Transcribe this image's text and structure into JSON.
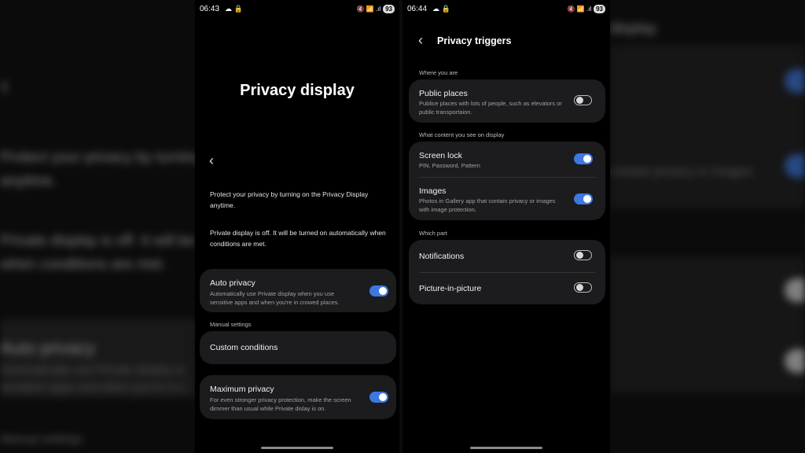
{
  "colors": {
    "accent": "#3d78e0",
    "card": "#1c1c1e",
    "background": "#000000"
  },
  "background_blur": {
    "left_lines": [
      "Protect your privacy by turning",
      "anytime.",
      "Private display is off. It will be",
      "when conditions are met.",
      "Auto privacy",
      "Automatically use Private display w",
      "sensitive apps and when you're in c",
      "Manual settings"
    ],
    "right_lines": [
      "display",
      "contain privacy or images"
    ]
  },
  "screen1": {
    "status": {
      "time": "06:43",
      "left_icons": "☁ 🔒",
      "right_icons": "🔇 📶 .ıl",
      "battery": "93"
    },
    "title": "Privacy display",
    "back_icon": "chevron-left-icon",
    "intro": "Protect your privacy by turning on the Privacy Display anytime.",
    "status_text": "Private display is off. It will be turned on automatically when conditions are met.",
    "auto_privacy": {
      "title": "Auto privacy",
      "subtitle": "Automatically use Private display when you use sensitive apps and when you're in crowed places.",
      "enabled": true
    },
    "manual_label": "Manual settings",
    "custom_conditions": {
      "title": "Custom conditions"
    },
    "maximum_privacy": {
      "title": "Maximum privacy",
      "subtitle": "For even stronger privacy protection, make the screen dimmer than usual while Private dislay is on.",
      "enabled": true
    }
  },
  "screen2": {
    "status": {
      "time": "06:44",
      "left_icons": "☁ 🔒",
      "right_icons": "🔇 📶 .ıl",
      "battery": "93"
    },
    "title": "Privacy triggers",
    "where_label": "Where you are",
    "public_places": {
      "title": "Public places",
      "subtitle": "Publice places with lots of people, such as elevators or public transportaion.",
      "enabled": false
    },
    "content_label": "What content you see on display",
    "screen_lock": {
      "title": "Screen lock",
      "subtitle": "PIN, Password, Pattern",
      "enabled": true
    },
    "images": {
      "title": "Images",
      "subtitle": "Photos in Gallery app that contain privacy or images with image protection.",
      "enabled": true
    },
    "which_part_label": "Which part",
    "notifications": {
      "title": "Notifications",
      "enabled": false
    },
    "pip": {
      "title": "Picture-in-picture",
      "enabled": false
    }
  }
}
